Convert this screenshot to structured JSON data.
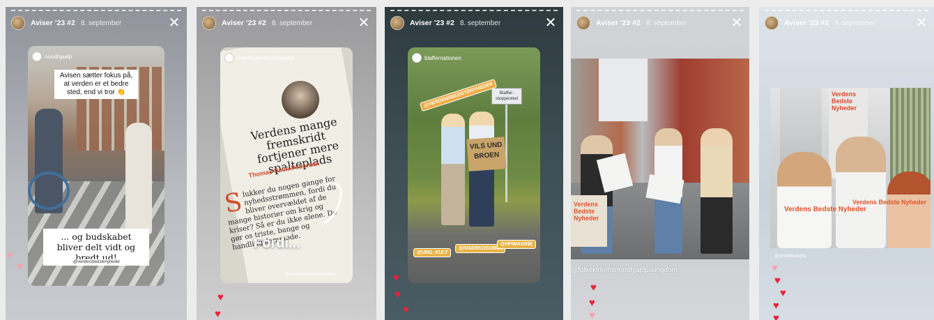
{
  "stories": [
    {
      "account": "Aviser ’23 #2",
      "date": "8. september",
      "tag": "noedhjaelp",
      "caption_top": "Avisen sætter fokus på, at verden er et bedre sted, end vi tror 👏",
      "caption_bottom": "... og budskabet bliver delt vidt og bredt ud!",
      "mention": "@verdensbedstenyheder"
    },
    {
      "account": "Aviser ’23 #2",
      "date": "8. september",
      "tag": "hotelfrederiksdalsinatur",
      "headline": "Verdens mange fremskridt fortjener mere spalteplads",
      "byline": "Thomas Ravn-Pedersen",
      "body": "lukker du nogen gange for nyhedsstrømmen, fordi du bliver overvældet af de mange historier om krig og kriser? Så er du ikke alene. De gør os triste, bange og handlingslammede.",
      "dropcap": "S",
      "overlay_text": "Fordi...",
      "mention": "@verdensbedstenyheder"
    },
    {
      "account": "Aviser ’23 #2",
      "date": "8. september",
      "tag": "blaffernationen",
      "sign_text": "VILS UND BROEN",
      "busstop_text": "Blaffer-stoppested",
      "stickers": [
        "@VERDENSBEDSTENYHEDER",
        "@UNG_KULT",
        "@IVAERKOGUMMI",
        "@HFIMAGINE"
      ]
    },
    {
      "account": "Aviser ’23 #2",
      "date": "8. september",
      "bag_text": "Verdens Bedste Nyheder",
      "mention": "@folkekirkensnoedhjaelpsungdom"
    },
    {
      "account": "Aviser ’23 #2",
      "date": "9. september",
      "poster_text": "Verdens Bedste Nyheder",
      "shirt_text": "Verdens Bedste Nyheder",
      "mention": "@annelouisea"
    }
  ],
  "icons": {
    "close": "close-icon",
    "heart": "heart-icon",
    "avatar": "avatar"
  },
  "colors": {
    "heart": "#e8233a",
    "accent_orange": "#e2542c"
  }
}
